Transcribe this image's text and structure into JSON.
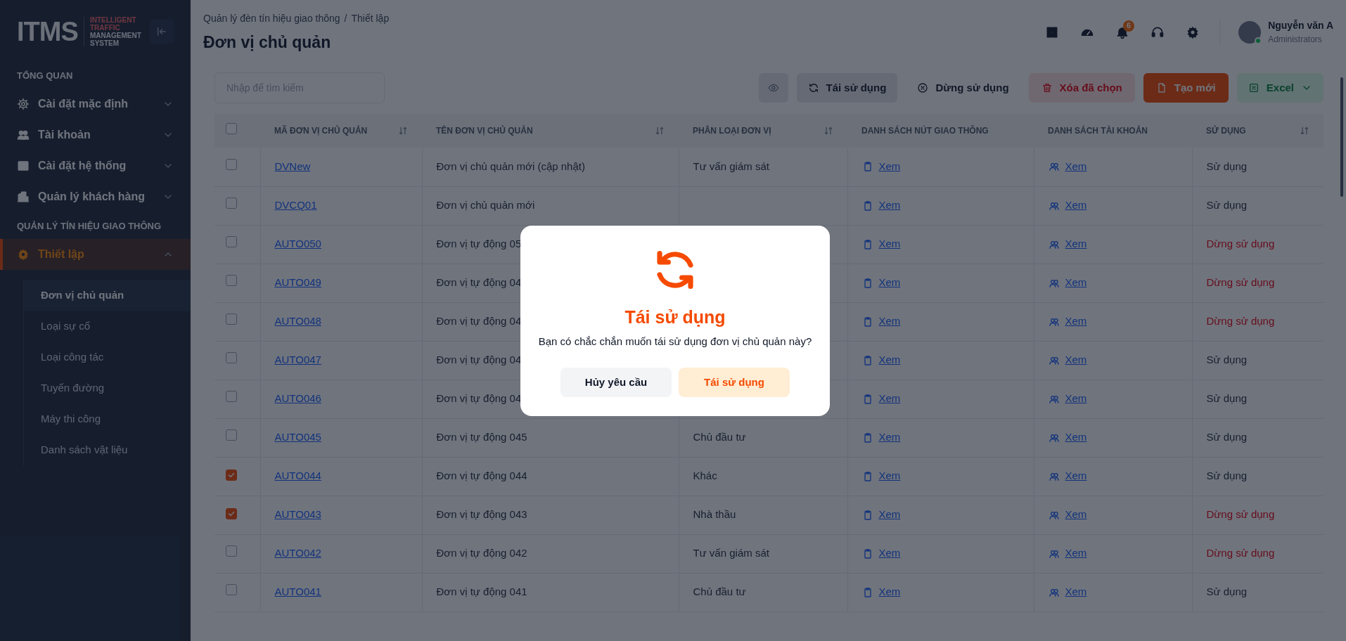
{
  "logo": {
    "mark": "ITMS",
    "tagline": [
      "INTELLIGENT",
      "TRAFFIC",
      "MANAGEMENT",
      "SYSTEM"
    ]
  },
  "sidebar": {
    "sections": [
      {
        "heading": "TỔNG QUAN",
        "items": [
          {
            "label": "Cài đặt mặc định",
            "expanded": false,
            "selected": false
          },
          {
            "label": "Tài khoản",
            "expanded": false,
            "selected": false
          },
          {
            "label": "Cài đặt hệ thống",
            "expanded": false,
            "selected": false
          },
          {
            "label": "Quản lý khách hàng",
            "expanded": false,
            "selected": false
          }
        ]
      },
      {
        "heading": "QUẢN LÝ TÍN HIỆU GIAO THÔNG",
        "items": [
          {
            "label": "Thiết lập",
            "expanded": true,
            "selected": true,
            "children": [
              {
                "label": "Đơn vị chủ quản",
                "selected": true
              },
              {
                "label": "Loại sự cố",
                "selected": false
              },
              {
                "label": "Loại công tác",
                "selected": false
              },
              {
                "label": "Tuyến đường",
                "selected": false
              },
              {
                "label": "Máy thi công",
                "selected": false
              },
              {
                "label": "Danh sách vật liệu",
                "selected": false
              }
            ]
          }
        ]
      }
    ]
  },
  "header": {
    "breadcrumb": [
      "Quản lý đèn tín hiệu giao thông",
      "Thiết lập"
    ],
    "breadcrumb_separator": "/",
    "title": "Đơn vị chủ quản",
    "notification_count": "6",
    "user": {
      "name": "Nguyễn văn A",
      "role": "Administrators",
      "online": true
    }
  },
  "toolbar": {
    "search": {
      "placeholder": "Nhập để tìm kiếm"
    },
    "buttons": [
      {
        "kind": "icon"
      },
      {
        "kind": "reuse",
        "label": "Tái sử dụng"
      },
      {
        "kind": "stop",
        "label": "Dừng sử dụng"
      },
      {
        "kind": "delete",
        "label": "Xóa đã chọn"
      },
      {
        "kind": "create",
        "label": "Tạo mới"
      },
      {
        "kind": "excel",
        "label": "Excel"
      }
    ]
  },
  "table": {
    "all_checked": false,
    "columns": [
      {
        "label": "MÃ ĐƠN VỊ CHỦ QUẢN",
        "sortable": true
      },
      {
        "label": "TÊN ĐƠN VỊ CHỦ QUẢN",
        "sortable": true
      },
      {
        "label": "PHÂN LOẠI ĐƠN VỊ",
        "sortable": true
      },
      {
        "label": "DANH SÁCH NÚT GIAO THÔNG",
        "sortable": false
      },
      {
        "label": "DANH SÁCH TÀI KHOẢN",
        "sortable": false
      },
      {
        "label": "SỬ DỤNG",
        "sortable": true
      }
    ],
    "rows": [
      {
        "checked": false,
        "code": "DVNew",
        "name": "Đơn vị chủ quản mới (cập nhật)",
        "type": "Tư vấn giám sát",
        "nodes": "Xem",
        "accounts": "Xem",
        "status": "Sử dụng",
        "stopped": false
      },
      {
        "checked": false,
        "code": "DVCQ01",
        "name": "Đơn vị chủ quản mới",
        "type": null,
        "nodes": "Xem",
        "accounts": "Xem",
        "status": "Sử dụng",
        "stopped": false
      },
      {
        "checked": false,
        "code": "AUTO050",
        "name": "Đơn vị tự động 05",
        "type": null,
        "nodes": "Xem",
        "accounts": "Xem",
        "status": "Dừng sử dụng",
        "stopped": true
      },
      {
        "checked": false,
        "code": "AUTO049",
        "name": "Đơn vị tự động 04",
        "type": null,
        "nodes": "Xem",
        "accounts": "Xem",
        "status": "Dừng sử dụng",
        "stopped": true
      },
      {
        "checked": false,
        "code": "AUTO048",
        "name": "Đơn vị tự động 04",
        "type": null,
        "nodes": "Xem",
        "accounts": "Xem",
        "status": "Dừng sử dụng",
        "stopped": true
      },
      {
        "checked": false,
        "code": "AUTO047",
        "name": "Đơn vị tự động 04",
        "type": null,
        "nodes": "Xem",
        "accounts": "Xem",
        "status": "Sử dụng",
        "stopped": false
      },
      {
        "checked": false,
        "code": "AUTO046",
        "name": "Đơn vị tự động 04",
        "type": null,
        "nodes": "Xem",
        "accounts": "Xem",
        "status": "Sử dụng",
        "stopped": false
      },
      {
        "checked": false,
        "code": "AUTO045",
        "name": "Đơn vị tự động 045",
        "type": "Chủ đầu tư",
        "nodes": "Xem",
        "accounts": "Xem",
        "status": "Sử dụng",
        "stopped": false
      },
      {
        "checked": true,
        "code": "AUTO044",
        "name": "Đơn vị tự động 044",
        "type": "Khác",
        "nodes": "Xem",
        "accounts": "Xem",
        "status": "Sử dụng",
        "stopped": false
      },
      {
        "checked": true,
        "code": "AUTO043",
        "name": "Đơn vị tự động 043",
        "type": "Nhà thầu",
        "nodes": "Xem",
        "accounts": "Xem",
        "status": "Dừng sử dụng",
        "stopped": true
      },
      {
        "checked": false,
        "code": "AUTO042",
        "name": "Đơn vị tự động 042",
        "type": "Tư vấn giám sát",
        "nodes": "Xem",
        "accounts": "Xem",
        "status": "Dừng sử dụng",
        "stopped": true
      },
      {
        "checked": false,
        "code": "AUTO041",
        "name": "Đơn vị tự động 041",
        "type": "Chủ đầu tư",
        "nodes": "Xem",
        "accounts": "Xem",
        "status": "Sử dụng",
        "stopped": false
      }
    ]
  },
  "dialog": {
    "title": "Tái sử dụng",
    "message": "Bạn có chắc chắn muốn tái sử dụng đơn vị chủ quản này?",
    "buttons": [
      {
        "kind": "cancel",
        "label": "Hủy yêu cầu"
      },
      {
        "kind": "confirm",
        "label": "Tái sử dụng"
      }
    ]
  }
}
